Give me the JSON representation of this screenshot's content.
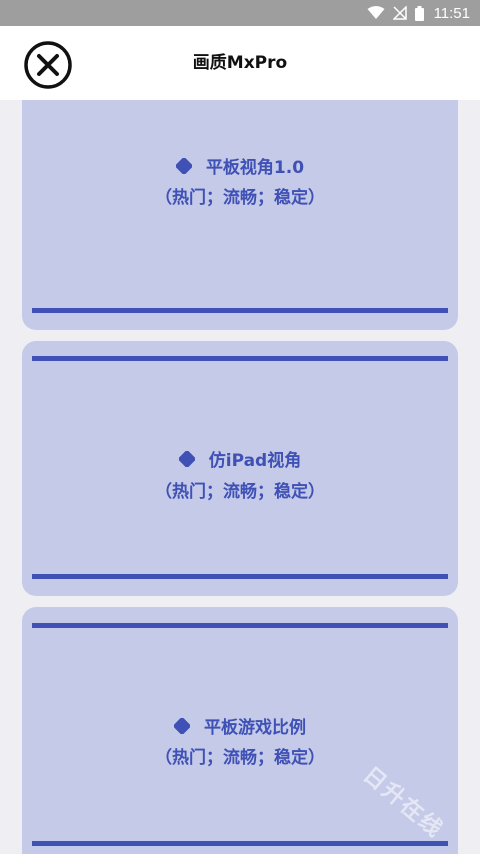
{
  "status_bar": {
    "time": "11:51",
    "icons": [
      "wifi-icon",
      "no-signal-icon",
      "battery-icon"
    ]
  },
  "header": {
    "title": "画质MxPro",
    "close_icon": "close-circle-icon"
  },
  "options": [
    {
      "name": "平板视角1.0",
      "tags": "（热门；流畅；稳定）"
    },
    {
      "name": "仿iPad视角",
      "tags": "（热门；流畅；稳定）"
    },
    {
      "name": "平板游戏比例",
      "tags": "（热门；流畅；稳定）"
    }
  ],
  "colors": {
    "accent": "#3f51b5",
    "card_bg": "#c5cae9",
    "page_bg": "#efeff3",
    "status_bar": "#9e9e9e"
  },
  "watermark": "日升在线"
}
